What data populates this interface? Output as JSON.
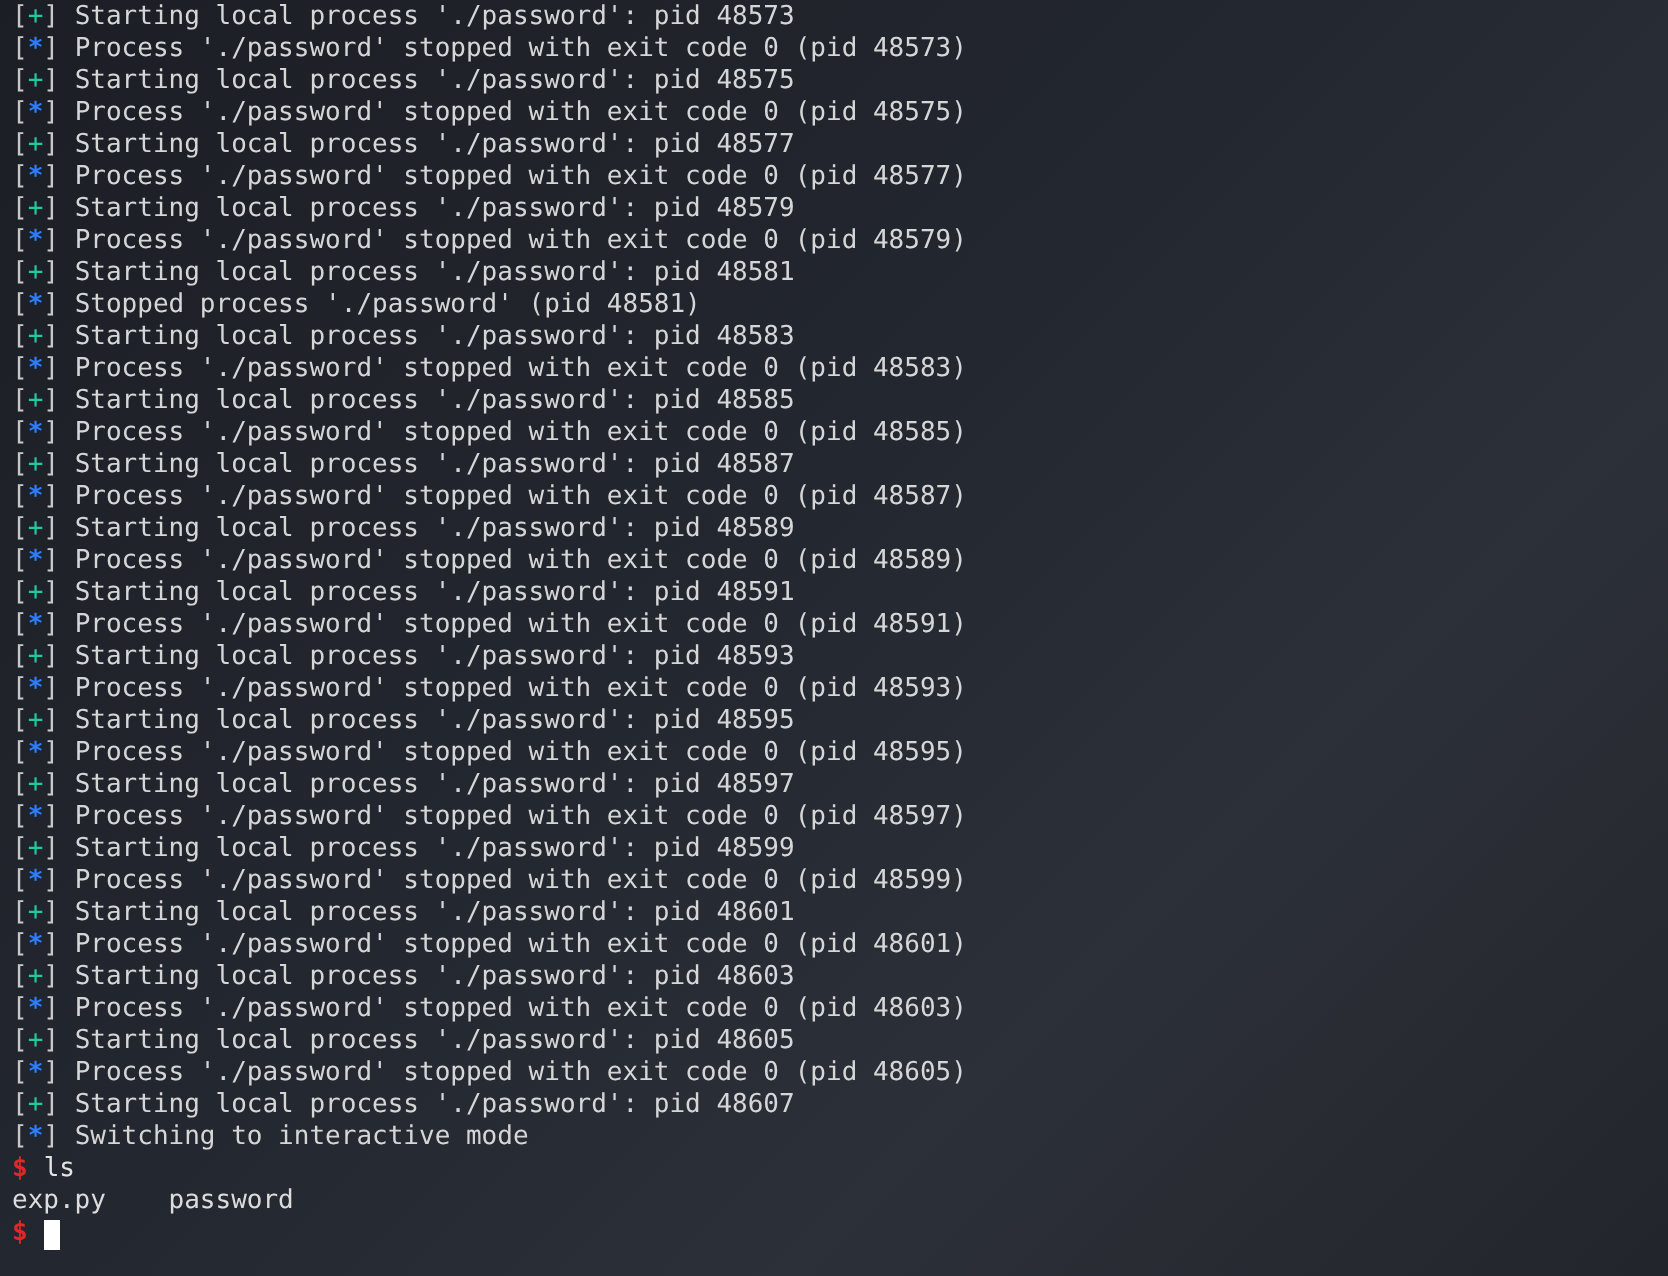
{
  "terminal": {
    "lines": [
      {
        "kind": "plus",
        "open": "[",
        "marker": "+",
        "close": "]",
        "text": "Starting local process './password': pid 48573"
      },
      {
        "kind": "star",
        "open": "[",
        "marker": "*",
        "close": "]",
        "text": "Process './password' stopped with exit code 0 (pid 48573)"
      },
      {
        "kind": "plus",
        "open": "[",
        "marker": "+",
        "close": "]",
        "text": "Starting local process './password': pid 48575"
      },
      {
        "kind": "star",
        "open": "[",
        "marker": "*",
        "close": "]",
        "text": "Process './password' stopped with exit code 0 (pid 48575)"
      },
      {
        "kind": "plus",
        "open": "[",
        "marker": "+",
        "close": "]",
        "text": "Starting local process './password': pid 48577"
      },
      {
        "kind": "star",
        "open": "[",
        "marker": "*",
        "close": "]",
        "text": "Process './password' stopped with exit code 0 (pid 48577)"
      },
      {
        "kind": "plus",
        "open": "[",
        "marker": "+",
        "close": "]",
        "text": "Starting local process './password': pid 48579"
      },
      {
        "kind": "star",
        "open": "[",
        "marker": "*",
        "close": "]",
        "text": "Process './password' stopped with exit code 0 (pid 48579)"
      },
      {
        "kind": "plus",
        "open": "[",
        "marker": "+",
        "close": "]",
        "text": "Starting local process './password': pid 48581"
      },
      {
        "kind": "star",
        "open": "[",
        "marker": "*",
        "close": "]",
        "text": "Stopped process './password' (pid 48581)"
      },
      {
        "kind": "plus",
        "open": "[",
        "marker": "+",
        "close": "]",
        "text": "Starting local process './password': pid 48583"
      },
      {
        "kind": "star",
        "open": "[",
        "marker": "*",
        "close": "]",
        "text": "Process './password' stopped with exit code 0 (pid 48583)"
      },
      {
        "kind": "plus",
        "open": "[",
        "marker": "+",
        "close": "]",
        "text": "Starting local process './password': pid 48585"
      },
      {
        "kind": "star",
        "open": "[",
        "marker": "*",
        "close": "]",
        "text": "Process './password' stopped with exit code 0 (pid 48585)"
      },
      {
        "kind": "plus",
        "open": "[",
        "marker": "+",
        "close": "]",
        "text": "Starting local process './password': pid 48587"
      },
      {
        "kind": "star",
        "open": "[",
        "marker": "*",
        "close": "]",
        "text": "Process './password' stopped with exit code 0 (pid 48587)"
      },
      {
        "kind": "plus",
        "open": "[",
        "marker": "+",
        "close": "]",
        "text": "Starting local process './password': pid 48589"
      },
      {
        "kind": "star",
        "open": "[",
        "marker": "*",
        "close": "]",
        "text": "Process './password' stopped with exit code 0 (pid 48589)"
      },
      {
        "kind": "plus",
        "open": "[",
        "marker": "+",
        "close": "]",
        "text": "Starting local process './password': pid 48591"
      },
      {
        "kind": "star",
        "open": "[",
        "marker": "*",
        "close": "]",
        "text": "Process './password' stopped with exit code 0 (pid 48591)"
      },
      {
        "kind": "plus",
        "open": "[",
        "marker": "+",
        "close": "]",
        "text": "Starting local process './password': pid 48593"
      },
      {
        "kind": "star",
        "open": "[",
        "marker": "*",
        "close": "]",
        "text": "Process './password' stopped with exit code 0 (pid 48593)"
      },
      {
        "kind": "plus",
        "open": "[",
        "marker": "+",
        "close": "]",
        "text": "Starting local process './password': pid 48595"
      },
      {
        "kind": "star",
        "open": "[",
        "marker": "*",
        "close": "]",
        "text": "Process './password' stopped with exit code 0 (pid 48595)"
      },
      {
        "kind": "plus",
        "open": "[",
        "marker": "+",
        "close": "]",
        "text": "Starting local process './password': pid 48597"
      },
      {
        "kind": "star",
        "open": "[",
        "marker": "*",
        "close": "]",
        "text": "Process './password' stopped with exit code 0 (pid 48597)"
      },
      {
        "kind": "plus",
        "open": "[",
        "marker": "+",
        "close": "]",
        "text": "Starting local process './password': pid 48599"
      },
      {
        "kind": "star",
        "open": "[",
        "marker": "*",
        "close": "]",
        "text": "Process './password' stopped with exit code 0 (pid 48599)"
      },
      {
        "kind": "plus",
        "open": "[",
        "marker": "+",
        "close": "]",
        "text": "Starting local process './password': pid 48601"
      },
      {
        "kind": "star",
        "open": "[",
        "marker": "*",
        "close": "]",
        "text": "Process './password' stopped with exit code 0 (pid 48601)"
      },
      {
        "kind": "plus",
        "open": "[",
        "marker": "+",
        "close": "]",
        "text": "Starting local process './password': pid 48603"
      },
      {
        "kind": "star",
        "open": "[",
        "marker": "*",
        "close": "]",
        "text": "Process './password' stopped with exit code 0 (pid 48603)"
      },
      {
        "kind": "plus",
        "open": "[",
        "marker": "+",
        "close": "]",
        "text": "Starting local process './password': pid 48605"
      },
      {
        "kind": "star",
        "open": "[",
        "marker": "*",
        "close": "]",
        "text": "Process './password' stopped with exit code 0 (pid 48605)"
      },
      {
        "kind": "plus",
        "open": "[",
        "marker": "+",
        "close": "]",
        "text": "Starting local process './password': pid 48607"
      },
      {
        "kind": "star",
        "open": "[",
        "marker": "*",
        "close": "]",
        "text": "Switching to interactive mode"
      },
      {
        "kind": "prompt",
        "marker": "$",
        "text": "ls"
      },
      {
        "kind": "output",
        "text": "exp.py    password"
      },
      {
        "kind": "prompt",
        "marker": "$",
        "cursor": true
      }
    ]
  }
}
